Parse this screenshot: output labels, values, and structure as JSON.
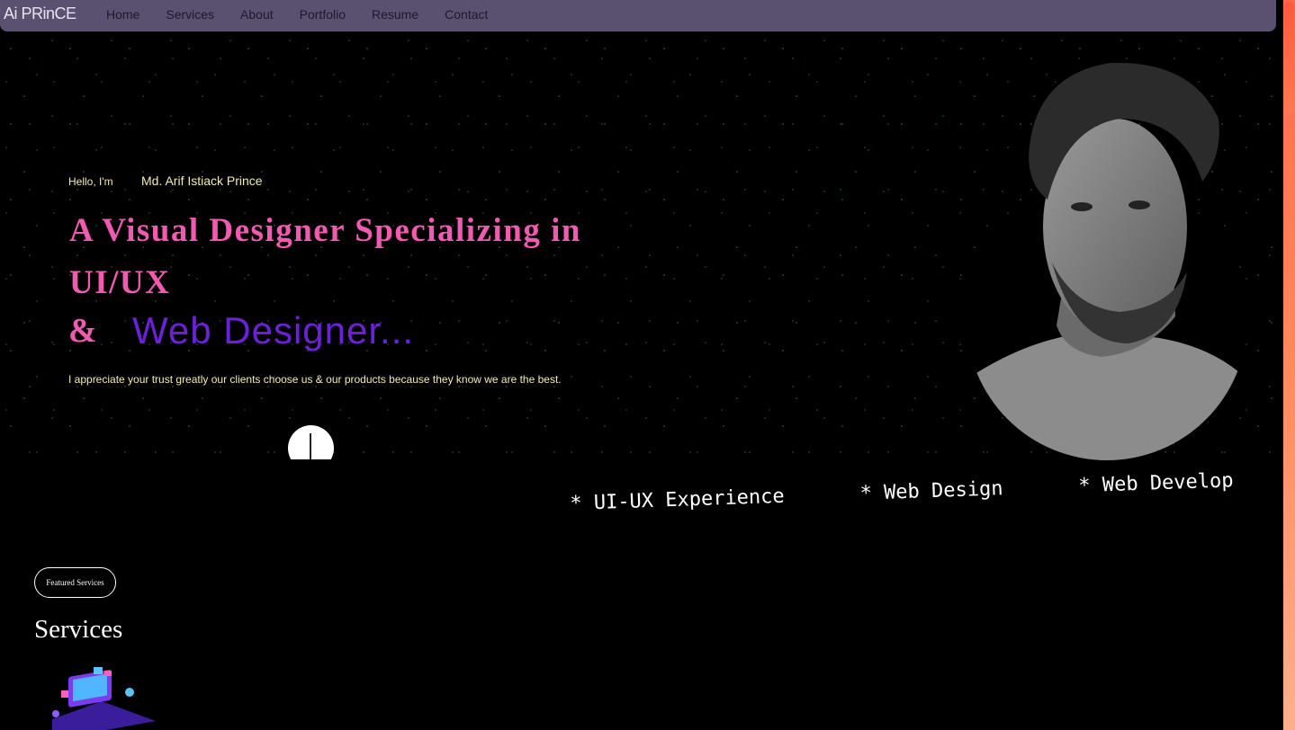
{
  "nav": {
    "logo": "Ai PRinCE",
    "links": [
      "Home",
      "Services",
      "About",
      "Portfolio",
      "Resume",
      "Contact"
    ]
  },
  "hero": {
    "greeting": "Hello, I'm",
    "name": "Md. Arif Istiack Prince",
    "headline": "A Visual Designer Specializing in UI/UX",
    "ampersand": "&",
    "typed_text": "Web Designer...",
    "tagline": "I appreciate your trust greatly our clients choose us & our products because they know we are the best."
  },
  "ticker": {
    "items": [
      "* UI-UX Experience",
      "* Web Design",
      "* Web Develop"
    ]
  },
  "services": {
    "badge": "Featured Services",
    "title": "Services"
  },
  "colors": {
    "accent_pink": "#f05bb1",
    "accent_purple": "#6b22d6",
    "cream_text": "#f3ecb0",
    "nav_bg": "#5a5070"
  },
  "icons": [
    "arrow-down-icon"
  ]
}
